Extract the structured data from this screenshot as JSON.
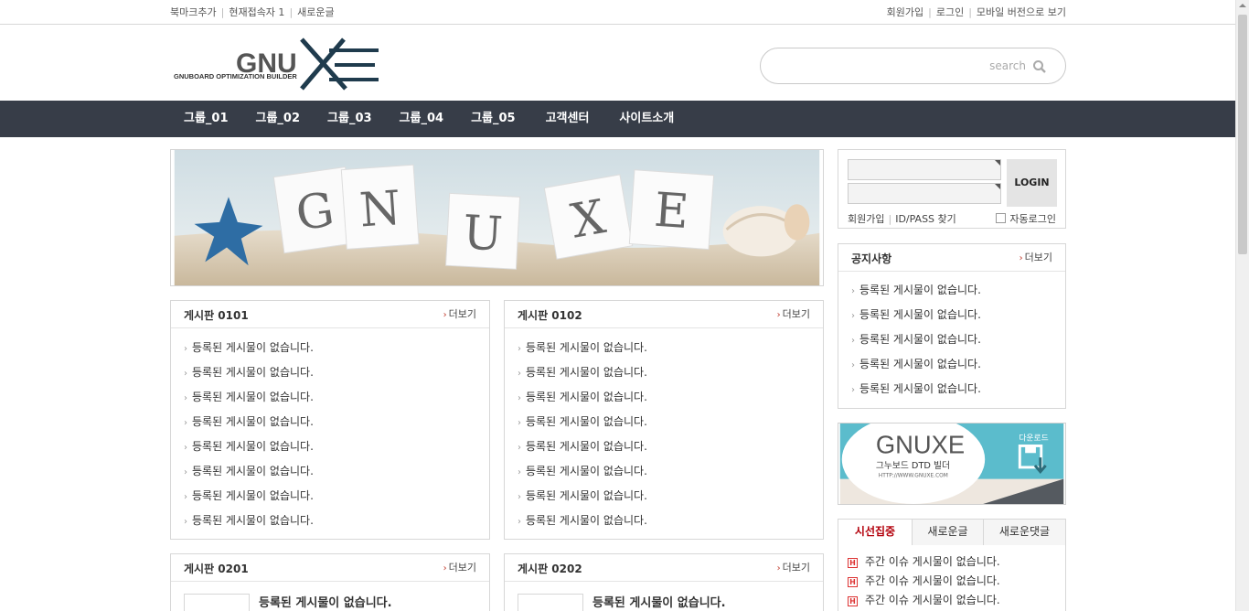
{
  "topbar": {
    "left": [
      "북마크추가",
      "현재접속자 1",
      "새로운글"
    ],
    "right": [
      "회원가입",
      "로그인",
      "모바일 버전으로 보기"
    ]
  },
  "logo": {
    "main": "GNUXE",
    "sub": "GNUBOARD OPTIMIZATION BUILDER"
  },
  "search": {
    "placeholder": "search",
    "value": ""
  },
  "nav": [
    "그룹_01",
    "그룹_02",
    "그룹_03",
    "그룹_04",
    "그룹_05",
    "고객센터",
    "사이트소개"
  ],
  "banner": {
    "letters": [
      "G",
      "N",
      "U",
      "X",
      "E"
    ]
  },
  "more_label": "더보기",
  "boards": [
    {
      "title": "게시판 0101",
      "items": [
        "등록된 게시물이 없습니다.",
        "등록된 게시물이 없습니다.",
        "등록된 게시물이 없습니다.",
        "등록된 게시물이 없습니다.",
        "등록된 게시물이 없습니다.",
        "등록된 게시물이 없습니다.",
        "등록된 게시물이 없습니다.",
        "등록된 게시물이 없습니다."
      ]
    },
    {
      "title": "게시판 0102",
      "items": [
        "등록된 게시물이 없습니다.",
        "등록된 게시물이 없습니다.",
        "등록된 게시물이 없습니다.",
        "등록된 게시물이 없습니다.",
        "등록된 게시물이 없습니다.",
        "등록된 게시물이 없습니다.",
        "등록된 게시물이 없습니다.",
        "등록된 게시물이 없습니다."
      ]
    }
  ],
  "gallery_boards": [
    {
      "title": "게시판 0201",
      "text": "등록된 게시물이 없습니다."
    },
    {
      "title": "게시판 0202",
      "text": "등록된 게시물이 없습니다."
    }
  ],
  "login": {
    "button": "LOGIN",
    "join": "회원가입",
    "find": "ID/PASS 찾기",
    "auto": "자동로그인"
  },
  "notice": {
    "title": "공지사항",
    "items": [
      "등록된 게시물이 없습니다.",
      "등록된 게시물이 없습니다.",
      "등록된 게시물이 없습니다.",
      "등록된 게시물이 없습니다.",
      "등록된 게시물이 없습니다."
    ]
  },
  "ad": {
    "title": "GNUXE",
    "subtitle": "그누보드 DTD 빌더",
    "url": "HTTP://WWW.GNUXE.COM",
    "download": "다운로드"
  },
  "tabs": {
    "labels": [
      "시선집중",
      "새로운글",
      "새로운댓글"
    ],
    "items": [
      "주간 이슈 게시물이 없습니다.",
      "주간 이슈 게시물이 없습니다.",
      "주간 이슈 게시물이 없습니다."
    ]
  },
  "colors": {
    "nav_bg": "#373d48",
    "accent_red": "#b3000b",
    "ad_teal": "#5bbccc"
  }
}
